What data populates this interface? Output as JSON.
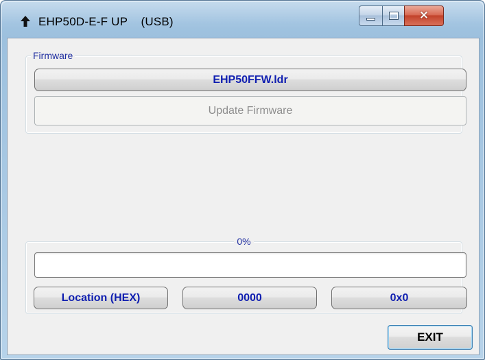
{
  "window": {
    "title": "EHP50D-E-F UP    (USB)",
    "icon": "up-arrow-icon",
    "controls": {
      "minimize": "minimize-icon",
      "maximize": "maximize-icon",
      "close": "×"
    }
  },
  "firmware_group": {
    "legend": "Firmware",
    "file_button": "EHP50FFW.ldr",
    "update_button": "Update Firmware",
    "update_enabled": false
  },
  "progress_group": {
    "percent_label": "0%",
    "progress_value": 0,
    "location_label": "Location (HEX)",
    "address_value": "0000",
    "data_value": "0x0"
  },
  "exit_button": "EXIT",
  "colors": {
    "accent_text": "#0f1eb0",
    "legend_text": "#1f2ea0",
    "disabled_text": "#8d8d8d",
    "close_button": "#c2422b",
    "frame": "#9cc0de"
  }
}
